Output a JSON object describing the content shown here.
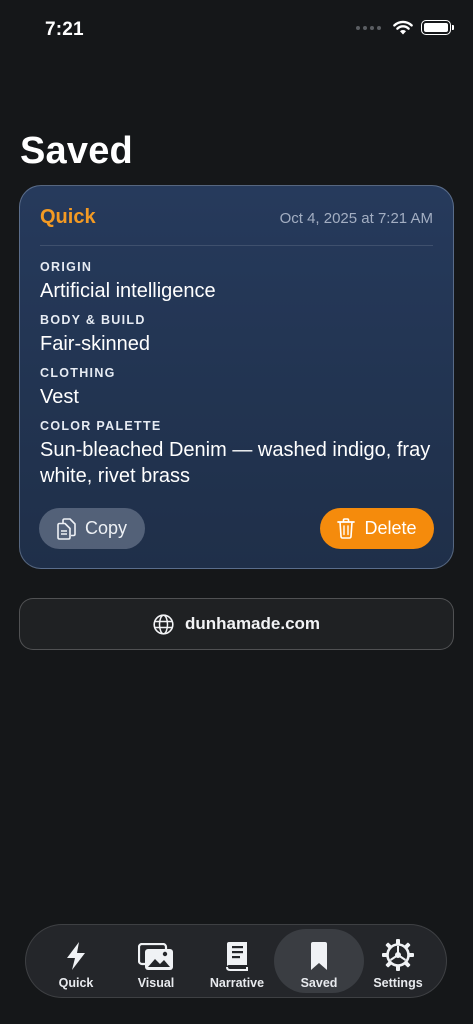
{
  "status_bar": {
    "time": "7:21"
  },
  "page": {
    "title": "Saved"
  },
  "card": {
    "mode": "Quick",
    "date": "Oct 4, 2025 at 7:21 AM",
    "fields": [
      {
        "label": "ORIGIN",
        "value": "Artificial intelligence"
      },
      {
        "label": "BODY & BUILD",
        "value": "Fair-skinned"
      },
      {
        "label": "CLOTHING",
        "value": "Vest"
      },
      {
        "label": "COLOR PALETTE",
        "value": "Sun-bleached Denim — washed indigo, fray white, rivet brass"
      }
    ],
    "copy_label": "Copy",
    "delete_label": "Delete"
  },
  "site": {
    "label": "dunhamade.com"
  },
  "tabs": [
    {
      "label": "Quick",
      "icon": "bolt-icon"
    },
    {
      "label": "Visual",
      "icon": "photos-icon"
    },
    {
      "label": "Narrative",
      "icon": "book-icon"
    },
    {
      "label": "Saved",
      "icon": "bookmark-icon",
      "active": true
    },
    {
      "label": "Settings",
      "icon": "gear-icon"
    }
  ],
  "colors": {
    "accent": "#f39a23",
    "delete": "#f58b0c",
    "card_bg": "#263a5c",
    "background": "#151719"
  }
}
